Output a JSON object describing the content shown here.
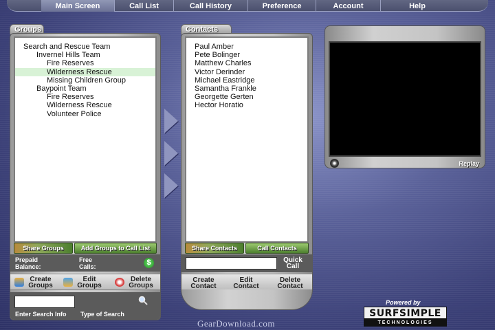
{
  "tabs": [
    {
      "label": "Main Screen",
      "active": true
    },
    {
      "label": "Call List",
      "active": false
    },
    {
      "label": "Call History",
      "active": false
    },
    {
      "label": "Preference",
      "active": false
    },
    {
      "label": "Account",
      "active": false
    },
    {
      "label": "Help",
      "active": false
    }
  ],
  "groups": {
    "title": "Groups",
    "items": [
      {
        "label": "Search and Rescue Team",
        "level": 0,
        "selected": false
      },
      {
        "label": "Invernel Hills Team",
        "level": 1,
        "selected": false
      },
      {
        "label": "Fire Reserves",
        "level": 2,
        "selected": false
      },
      {
        "label": "Wilderness Rescue",
        "level": 2,
        "selected": true
      },
      {
        "label": "Missing Children Group",
        "level": 2,
        "selected": false
      },
      {
        "label": "Baypoint Team",
        "level": 1,
        "selected": false
      },
      {
        "label": "Fire Reserves",
        "level": 2,
        "selected": false
      },
      {
        "label": "Wilderness Rescue",
        "level": 2,
        "selected": false
      },
      {
        "label": "Volunteer Police",
        "level": 2,
        "selected": false
      }
    ],
    "share_button": "Share Groups",
    "add_button": "Add Groups to Call List",
    "prepaid_line1": "Prepaid",
    "prepaid_line2": "Balance:",
    "free_line1": "Free",
    "free_line2": "Calls:",
    "dollar_icon": "dollar-icon",
    "create_line1": "Create",
    "create_line2": "Groups",
    "edit_line1": "Edit",
    "edit_line2": "Groups",
    "delete_line1": "Delete",
    "delete_line2": "Groups",
    "search_value": "",
    "enter_search_label": "Enter Search Info",
    "type_search_label": "Type of Search"
  },
  "contacts": {
    "title": "Contacts",
    "items": [
      "Paul Amber",
      "Pete Bolinger",
      "Matthew Charles",
      "Victor Derinder",
      "Michael Eastridge",
      "Samantha Frankle",
      "Georgette Gerten",
      "Hector Horatio"
    ],
    "share_button": "Share Contacts",
    "call_button": "Call Contacts",
    "quick_call_value": "",
    "quick_call_line1": "Quick",
    "quick_call_line2": "Call",
    "create_line1": "Create",
    "create_line2": "Contact",
    "edit_line1": "Edit",
    "edit_line2": "Contact",
    "delete_line1": "Delete",
    "delete_line2": "Contact"
  },
  "video": {
    "replay_label": "Replay"
  },
  "branding": {
    "powered_by": "Powered by",
    "brand_name": "SURFSIMPLE",
    "brand_sub": "TECHNOLOGIES",
    "watermark": "GearDownload.com"
  },
  "colors": {
    "accent_green": "#4c7f2e",
    "selection": "#d8f2d6",
    "background": "#3c4178"
  }
}
